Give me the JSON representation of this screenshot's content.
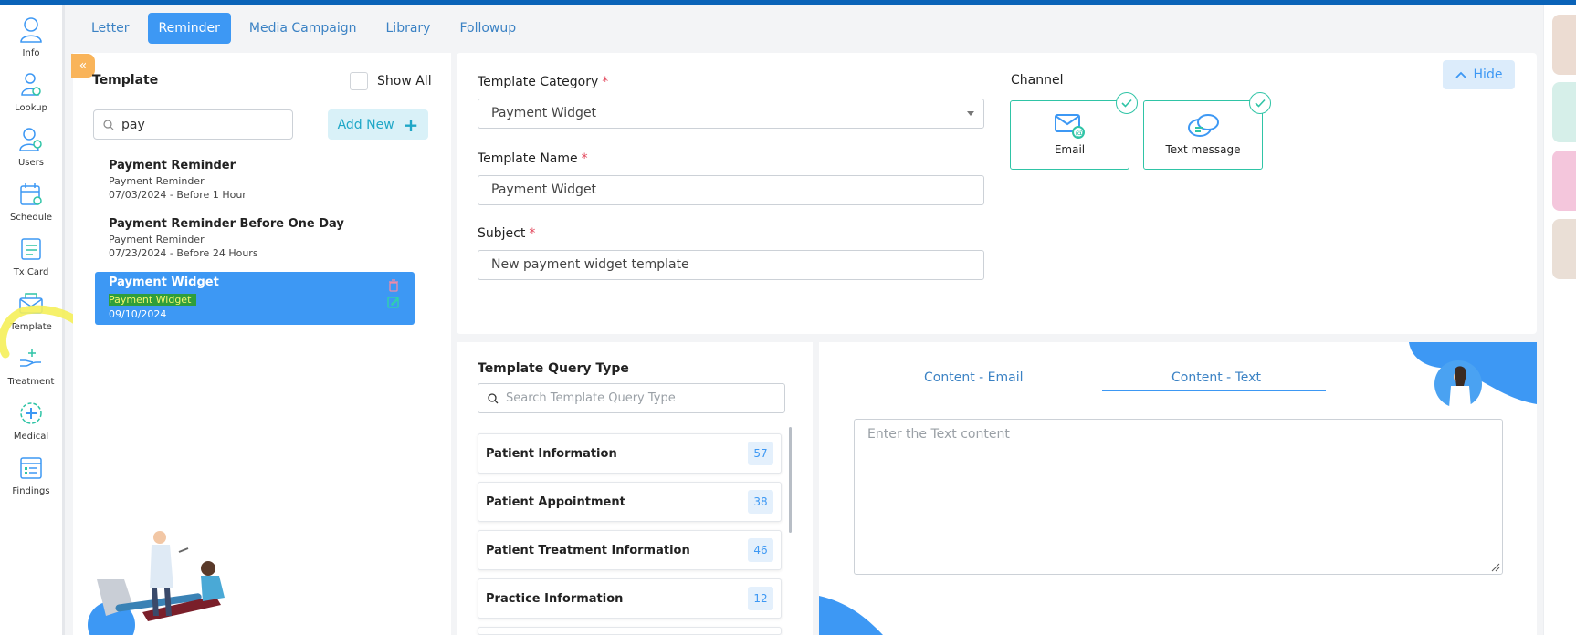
{
  "nav": {
    "items": [
      {
        "label": "Info",
        "icon": "user-icon"
      },
      {
        "label": "Lookup",
        "icon": "lookup-icon"
      },
      {
        "label": "Users",
        "icon": "users-icon"
      },
      {
        "label": "Schedule",
        "icon": "calendar-icon"
      },
      {
        "label": "Tx Card",
        "icon": "card-icon"
      },
      {
        "label": "Template",
        "icon": "envelope-icon"
      },
      {
        "label": "Treatment",
        "icon": "hand-icon"
      },
      {
        "label": "Medical",
        "icon": "medical-icon"
      },
      {
        "label": "Findings",
        "icon": "findings-icon"
      }
    ]
  },
  "tabs": [
    {
      "label": "Letter",
      "active": false
    },
    {
      "label": "Reminder",
      "active": true
    },
    {
      "label": "Media Campaign",
      "active": false
    },
    {
      "label": "Library",
      "active": false
    },
    {
      "label": "Followup",
      "active": false
    }
  ],
  "template_panel": {
    "title": "Template",
    "show_all_label": "Show All",
    "search_value": "pay",
    "add_new_label": "Add New",
    "items": [
      {
        "name": "Payment Reminder",
        "category": "Payment Reminder",
        "meta": "07/03/2024 - Before 1 Hour",
        "selected": false
      },
      {
        "name": "Payment Reminder Before One Day",
        "category": "Payment Reminder",
        "meta": "07/23/2024 - Before 24 Hours",
        "selected": false
      },
      {
        "name": "Payment Widget",
        "category": "Payment Widget",
        "meta": "09/10/2024",
        "selected": true
      }
    ]
  },
  "form": {
    "category_label": "Template Category",
    "category_value": "Payment Widget",
    "name_label": "Template Name",
    "name_value": "Payment Widget",
    "subject_label": "Subject",
    "subject_value": "New payment widget template",
    "required_mark": "*",
    "hide_label": "Hide"
  },
  "channel": {
    "title": "Channel",
    "options": [
      {
        "label": "Email",
        "checked": true
      },
      {
        "label": "Text message",
        "checked": true
      }
    ]
  },
  "query": {
    "title": "Template Query Type",
    "search_placeholder": "Search Template Query Type",
    "rows": [
      {
        "name": "Patient Information",
        "count": "57"
      },
      {
        "name": "Patient Appointment",
        "count": "38"
      },
      {
        "name": "Patient Treatment Information",
        "count": "46"
      },
      {
        "name": "Practice Information",
        "count": "12"
      }
    ]
  },
  "content": {
    "tabs": [
      "Content - Email",
      "Content - Text"
    ],
    "active_tab": "Content - Text",
    "text_placeholder": "Enter the Text content"
  },
  "colors": {
    "accent": "#3d98f4",
    "teal": "#2fc4a6",
    "highlight_yellow": "#f5f05a",
    "top_bar": "#0a63b8"
  }
}
